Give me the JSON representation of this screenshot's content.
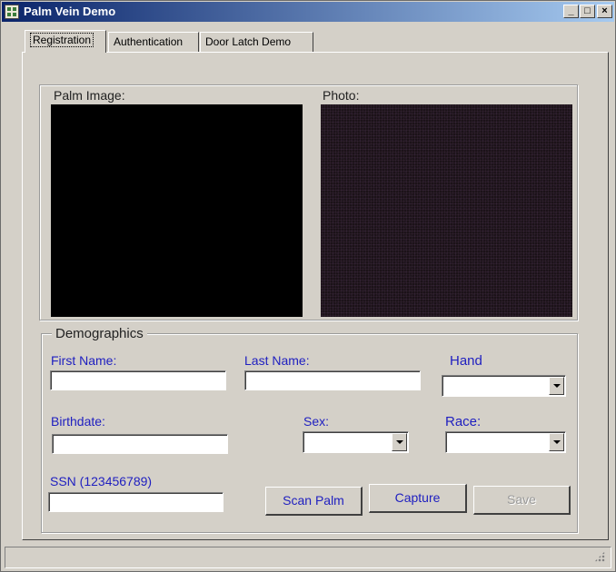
{
  "window": {
    "title": "Palm Vein Demo"
  },
  "titlebar_buttons": {
    "minimize": "_",
    "maximize": "□",
    "close": "×"
  },
  "tabs": [
    {
      "label": "Registration",
      "active": true
    },
    {
      "label": "Authentication",
      "active": false
    },
    {
      "label": "Door Latch Demo",
      "active": false
    }
  ],
  "images": {
    "palm_label": "Palm Image:",
    "photo_label": "Photo:"
  },
  "demographics": {
    "legend": "Demographics",
    "first_name": {
      "label": "First Name:",
      "value": ""
    },
    "last_name": {
      "label": "Last Name:",
      "value": ""
    },
    "hand": {
      "label": "Hand",
      "value": ""
    },
    "birthdate": {
      "label": "Birthdate:",
      "value": ""
    },
    "sex": {
      "label": "Sex:",
      "value": ""
    },
    "race": {
      "label": "Race:",
      "value": ""
    },
    "ssn": {
      "label": "SSN (123456789)",
      "value": ""
    }
  },
  "buttons": {
    "scan_palm": "Scan Palm",
    "capture": "Capture",
    "save": "Save"
  },
  "colors": {
    "title_start": "#0a246a",
    "title_end": "#a6caf0",
    "label_blue": "#2020c0",
    "face": "#d4d0c8"
  }
}
